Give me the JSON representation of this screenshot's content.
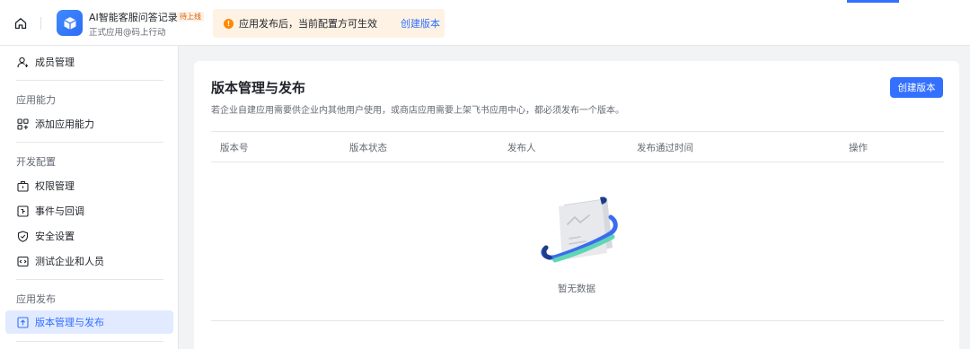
{
  "header": {
    "app_name": "AI智能客服问答记录",
    "status_tag": "待上线",
    "app_subtitle": "正式应用@码上行动",
    "notice_text": "应用发布后，当前配置方可生效",
    "notice_link": "创建版本",
    "notice_icon": "!"
  },
  "sidebar": {
    "member_item": "成员管理",
    "groups": [
      "应用能力",
      "开发配置",
      "应用发布"
    ],
    "capability_items": [
      "添加应用能力"
    ],
    "dev_items": [
      "权限管理",
      "事件与回调",
      "安全设置",
      "测试企业和人员"
    ],
    "release_items": [
      "版本管理与发布"
    ],
    "active_item": "版本管理与发布"
  },
  "main": {
    "title": "版本管理与发布",
    "description": "若企业自建应用需要供企业内其他用户使用，或商店应用需要上架飞书应用中心，都必须发布一个版本。",
    "create_button": "创建版本",
    "columns": [
      "版本号",
      "版本状态",
      "发布人",
      "发布通过时间",
      "操作"
    ],
    "empty_text": "暂无数据"
  },
  "colors": {
    "accent": "#3370ff",
    "notice_bg": "#fdf2e4",
    "active_bg": "#e1eaff"
  }
}
